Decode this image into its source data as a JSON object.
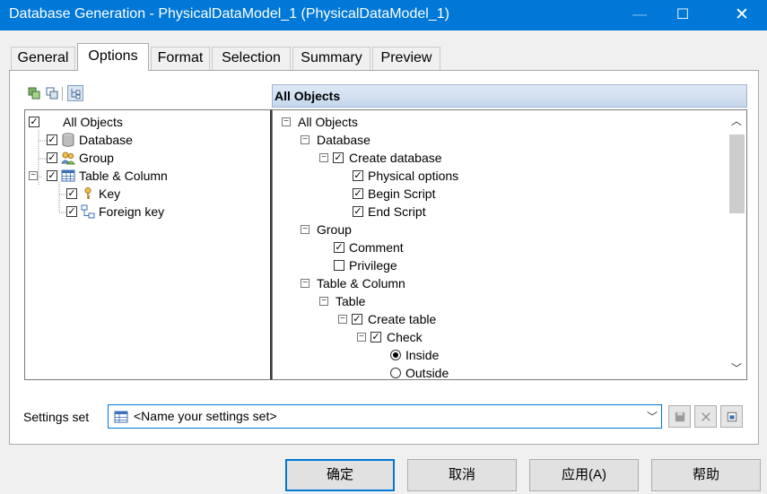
{
  "window": {
    "title": "Database Generation - PhysicalDataModel_1 (PhysicalDataModel_1)",
    "minimize_glyph": "—",
    "maximize_glyph": "☐",
    "close_glyph": "✕"
  },
  "tabs": [
    "General",
    "Options",
    "Format",
    "Selection",
    "Summary",
    "Preview"
  ],
  "active_tab": "Options",
  "left_tree": {
    "items": [
      {
        "label": "All Objects",
        "checked": true,
        "icon": "none"
      },
      {
        "label": "Database",
        "checked": true,
        "icon": "database-icon"
      },
      {
        "label": "Group",
        "checked": true,
        "icon": "group-icon"
      },
      {
        "label": "Table & Column",
        "checked": true,
        "icon": "table-icon",
        "expanded": true
      },
      {
        "label": "Key",
        "checked": true,
        "icon": "key-icon"
      },
      {
        "label": "Foreign key",
        "checked": true,
        "icon": "foreign-key-icon"
      }
    ]
  },
  "right_header": "All Objects",
  "right_tree": {
    "items": [
      {
        "label": "All Objects"
      },
      {
        "label": "Database"
      },
      {
        "label": "Create database",
        "checked": true
      },
      {
        "label": "Physical options",
        "checked": true
      },
      {
        "label": "Begin Script",
        "checked": true
      },
      {
        "label": "End Script",
        "checked": true
      },
      {
        "label": "Group"
      },
      {
        "label": "Comment",
        "checked": true
      },
      {
        "label": "Privilege",
        "checked": false
      },
      {
        "label": "Table & Column"
      },
      {
        "label": "Table"
      },
      {
        "label": "Create table",
        "checked": true
      },
      {
        "label": "Check",
        "checked": true
      },
      {
        "label": "Inside",
        "selected": true
      },
      {
        "label": "Outside",
        "selected": false
      }
    ]
  },
  "settings": {
    "label": "Settings set",
    "value": "<Name your settings set>"
  },
  "buttons": {
    "ok": "确定",
    "cancel": "取消",
    "apply": "应用(A)",
    "help": "帮助"
  },
  "colors": {
    "titlebar": "#0078d7",
    "header_gradient": "#c6d7ec"
  }
}
